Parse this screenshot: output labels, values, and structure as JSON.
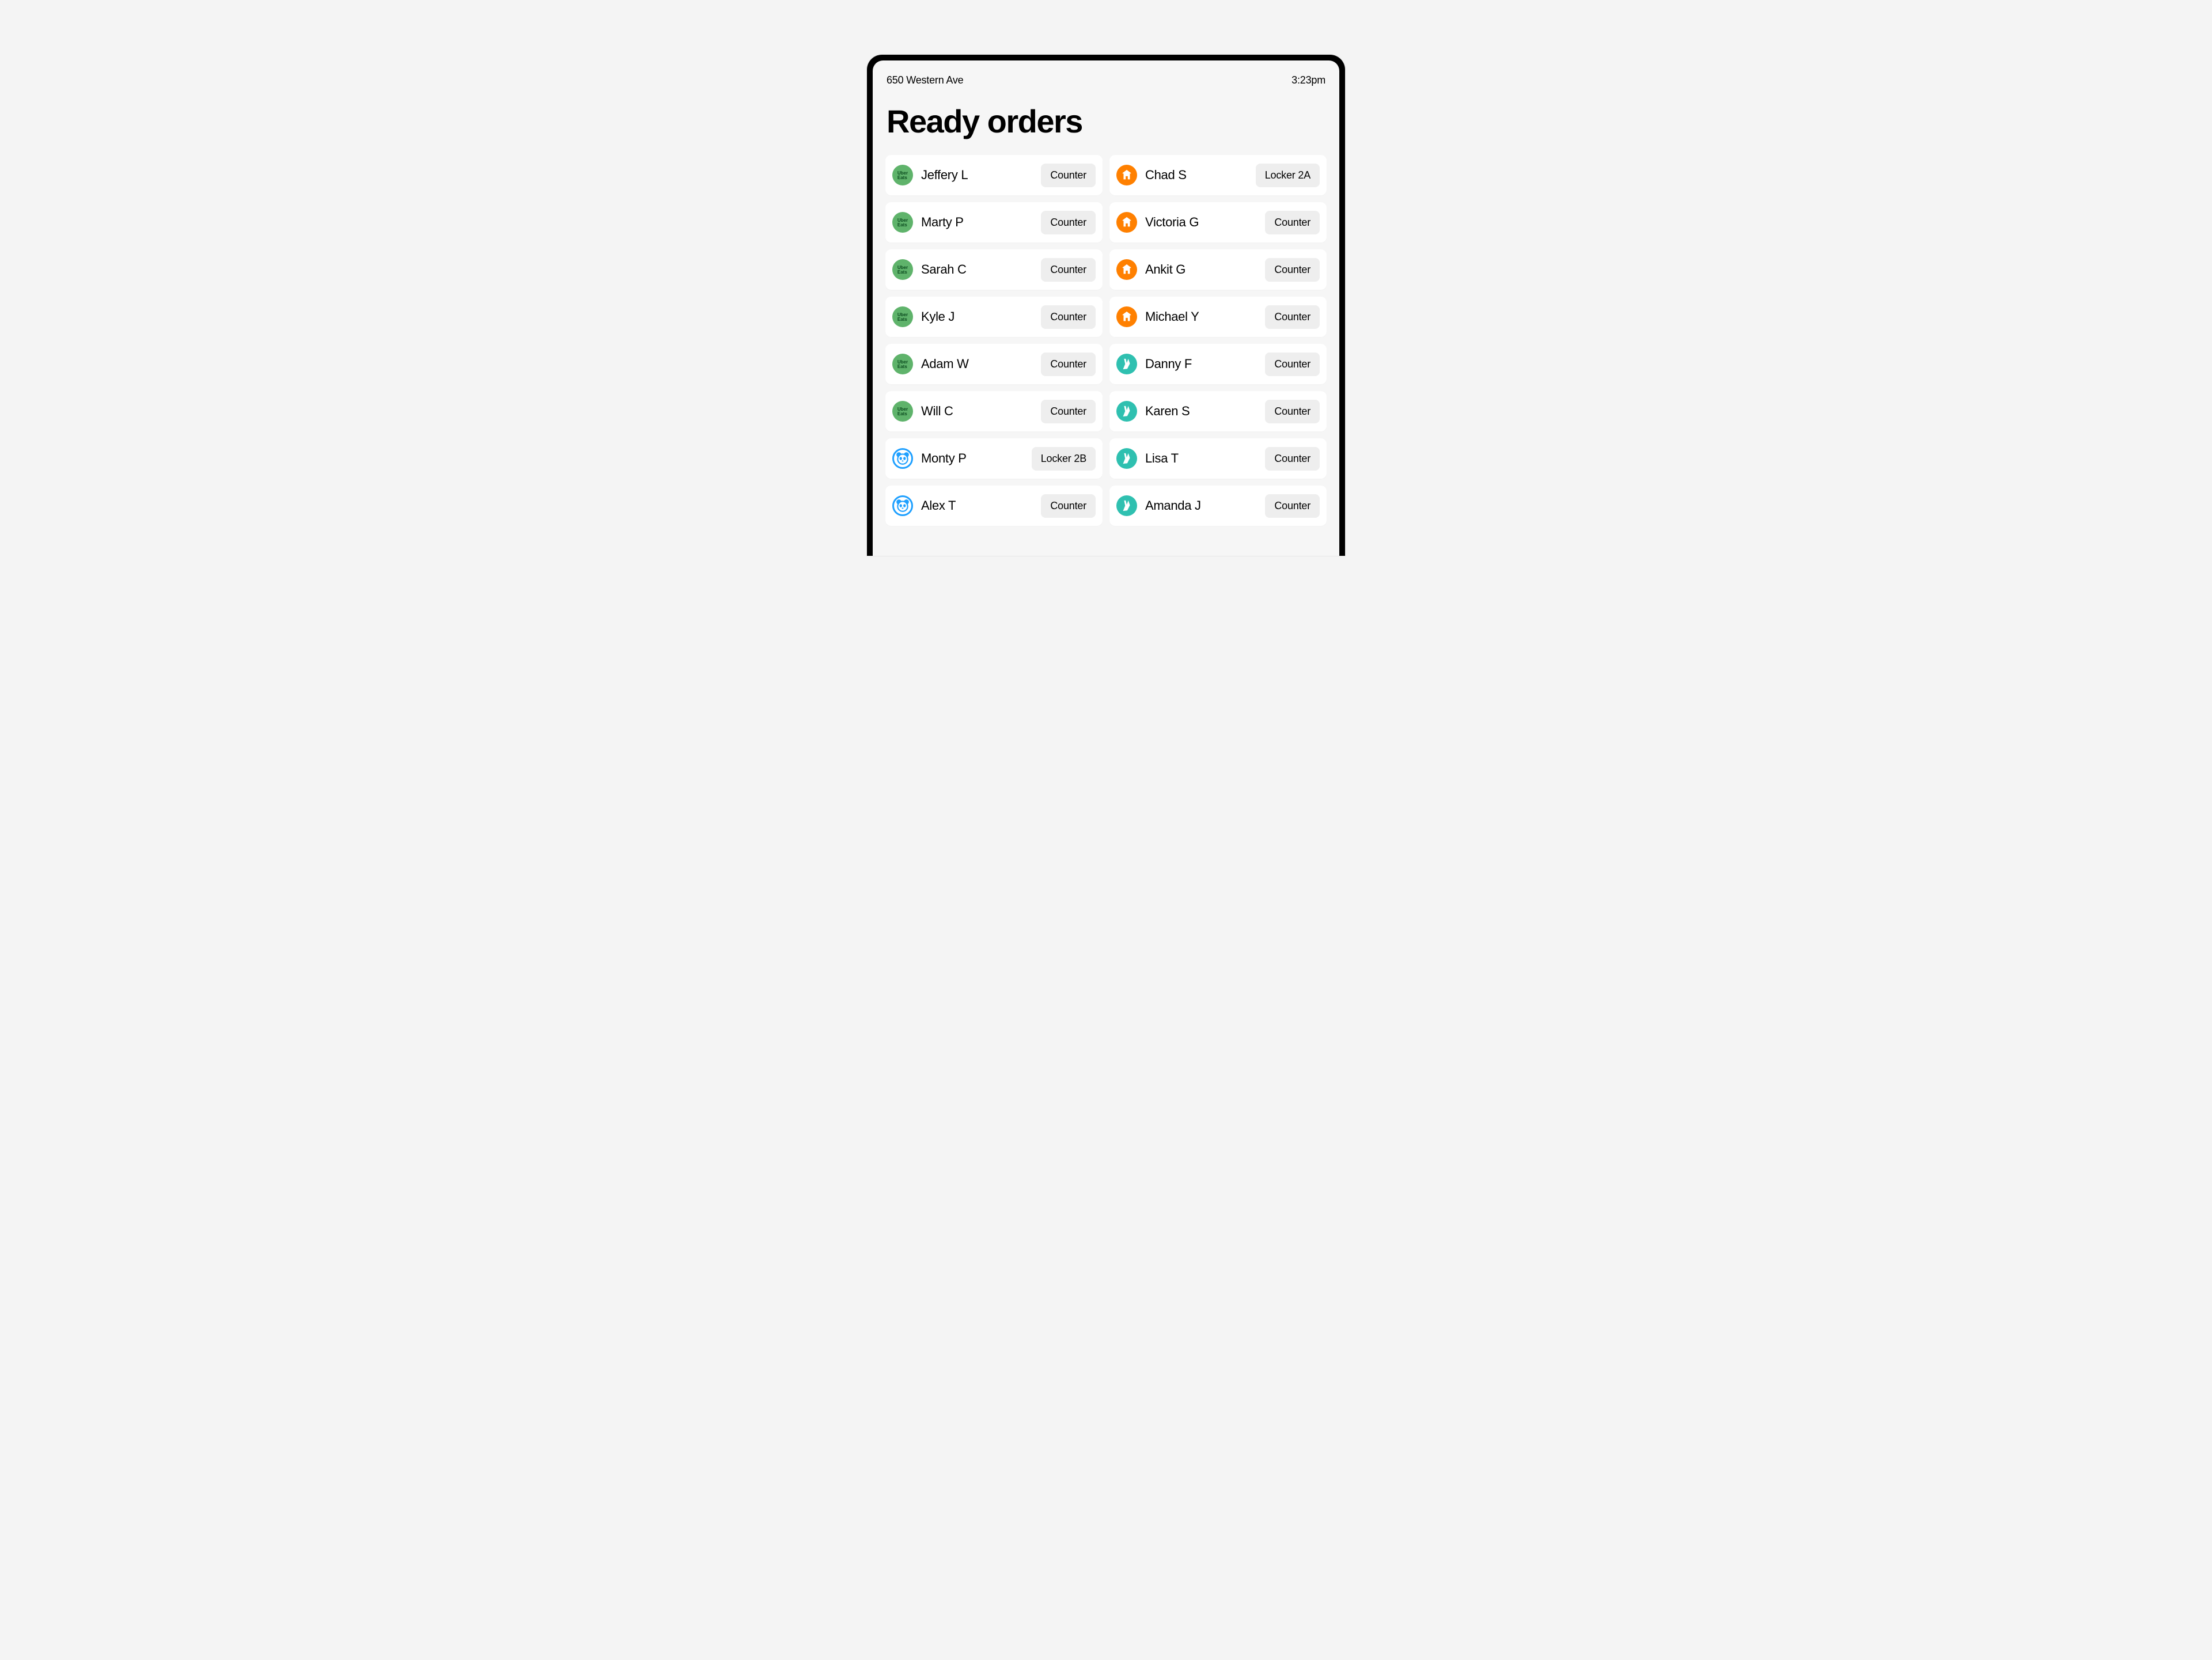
{
  "status_bar": {
    "location": "650 Western Ave",
    "time": "3:23pm"
  },
  "page_title": "Ready orders",
  "services": {
    "ubereats": {
      "label": "Uber Eats",
      "color": "#5fb36b"
    },
    "justeat": {
      "label": "Just Eat",
      "color": "#ff8000"
    },
    "deliveroo": {
      "label": "Deliveroo",
      "color": "#2fc0b0"
    },
    "hungrypanda": {
      "label": "HungryPanda",
      "color": "#1fa0ff"
    }
  },
  "orders": [
    {
      "service": "ubereats",
      "name": "Jeffery L",
      "pickup": "Counter"
    },
    {
      "service": "justeat",
      "name": "Chad S",
      "pickup": "Locker 2A"
    },
    {
      "service": "ubereats",
      "name": "Marty P",
      "pickup": "Counter"
    },
    {
      "service": "justeat",
      "name": "Victoria G",
      "pickup": "Counter"
    },
    {
      "service": "ubereats",
      "name": "Sarah C",
      "pickup": "Counter"
    },
    {
      "service": "justeat",
      "name": "Ankit G",
      "pickup": "Counter"
    },
    {
      "service": "ubereats",
      "name": "Kyle J",
      "pickup": "Counter"
    },
    {
      "service": "justeat",
      "name": "Michael Y",
      "pickup": "Counter"
    },
    {
      "service": "ubereats",
      "name": "Adam W",
      "pickup": "Counter"
    },
    {
      "service": "deliveroo",
      "name": "Danny F",
      "pickup": "Counter"
    },
    {
      "service": "ubereats",
      "name": "Will C",
      "pickup": "Counter"
    },
    {
      "service": "deliveroo",
      "name": "Karen S",
      "pickup": "Counter"
    },
    {
      "service": "hungrypanda",
      "name": "Monty P",
      "pickup": "Locker 2B"
    },
    {
      "service": "deliveroo",
      "name": "Lisa T",
      "pickup": "Counter"
    },
    {
      "service": "hungrypanda",
      "name": "Alex T",
      "pickup": "Counter"
    },
    {
      "service": "deliveroo",
      "name": "Amanda J",
      "pickup": "Counter"
    }
  ]
}
